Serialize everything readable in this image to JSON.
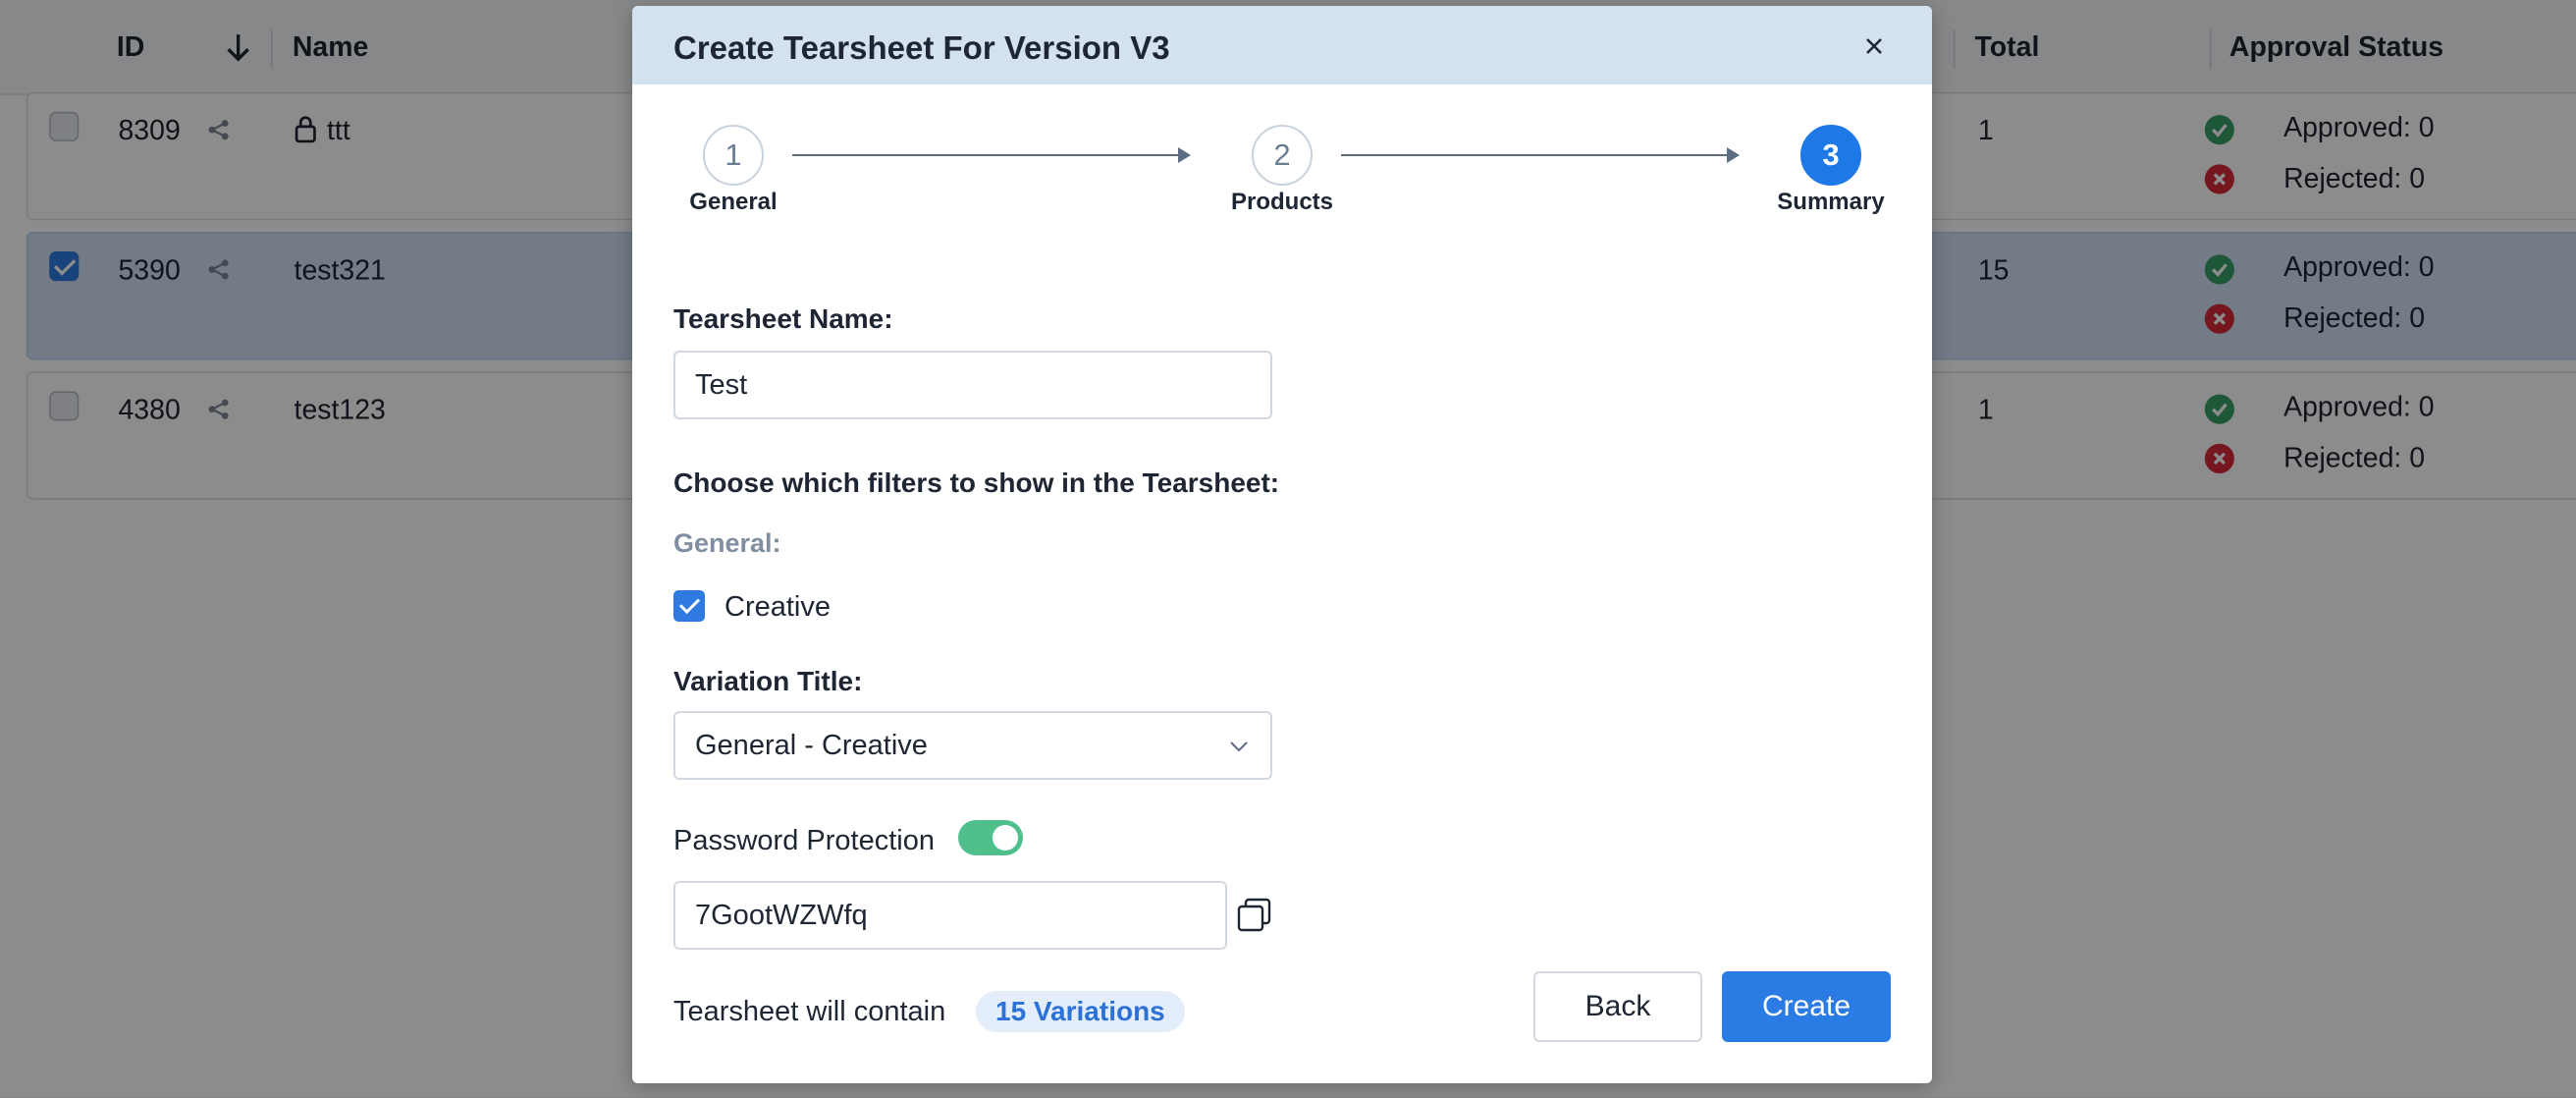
{
  "background": {
    "columns": [
      "ID",
      "Name",
      "Total",
      "Approval Status"
    ],
    "rows": [
      {
        "id": "8309",
        "name": "ttt",
        "locked": true,
        "selected": false,
        "total": "1",
        "approved": "Approved: 0",
        "rejected": "Rejected: 0"
      },
      {
        "id": "5390",
        "name": "test321",
        "locked": false,
        "selected": true,
        "total": "15",
        "approved": "Approved: 0",
        "rejected": "Rejected: 0"
      },
      {
        "id": "4380",
        "name": "test123",
        "locked": false,
        "selected": false,
        "total": "1",
        "approved": "Approved: 0",
        "rejected": "Rejected: 0"
      }
    ]
  },
  "modal": {
    "title": "Create Tearsheet For Version V3",
    "steps": [
      {
        "number": "1",
        "label": "General",
        "active": false
      },
      {
        "number": "2",
        "label": "Products",
        "active": false
      },
      {
        "number": "3",
        "label": "Summary",
        "active": true
      }
    ],
    "name_label": "Tearsheet Name:",
    "name_value": "Test",
    "filters_label": "Choose which filters to show in the Tearsheet:",
    "general_label": "General:",
    "creative_checkbox": {
      "label": "Creative",
      "checked": true
    },
    "variation_title_label": "Variation Title:",
    "variation_title_value": "General - Creative",
    "password_label": "Password Protection",
    "password_enabled": true,
    "password_value": "7GootWZWfq",
    "contain_text": "Tearsheet will contain",
    "variations_badge": "15 Variations",
    "back_label": "Back",
    "create_label": "Create"
  },
  "colors": {
    "accent": "#2a7be3",
    "header_bg": "#d4e1ef",
    "toggle_on": "#4fbf8c",
    "approved": "#3aa068",
    "rejected": "#d8283a"
  }
}
